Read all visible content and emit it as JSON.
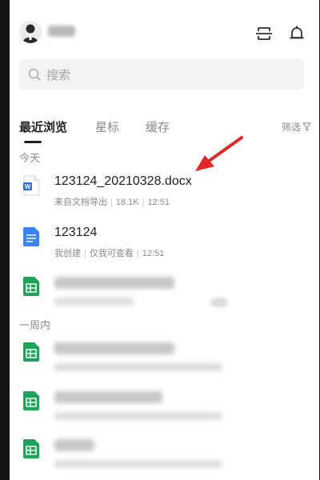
{
  "search": {
    "placeholder": "搜索"
  },
  "tabs": [
    {
      "label": "最近浏览",
      "active": true
    },
    {
      "label": "星标",
      "active": false
    },
    {
      "label": "缓存",
      "active": false
    }
  ],
  "filter_label": "筛选",
  "sections": {
    "today": "今天",
    "week": "一周内"
  },
  "files": [
    {
      "title": "123124_20210328.docx",
      "meta": [
        "来自文档导出",
        "18.1K",
        "12:51"
      ],
      "icon": "word-doc-icon"
    },
    {
      "title": "123124",
      "meta": [
        "我创建",
        "仅我可查看",
        "12:51"
      ],
      "icon": "doc-icon"
    }
  ],
  "colors": {
    "word_blue": "#2b6fd6",
    "doc_blue": "#3a82f6",
    "sheet_green": "#1ea35a",
    "annotation_red": "#e0282a",
    "text_dark": "#1f1f1f",
    "text_muted": "#8a8a8a"
  }
}
